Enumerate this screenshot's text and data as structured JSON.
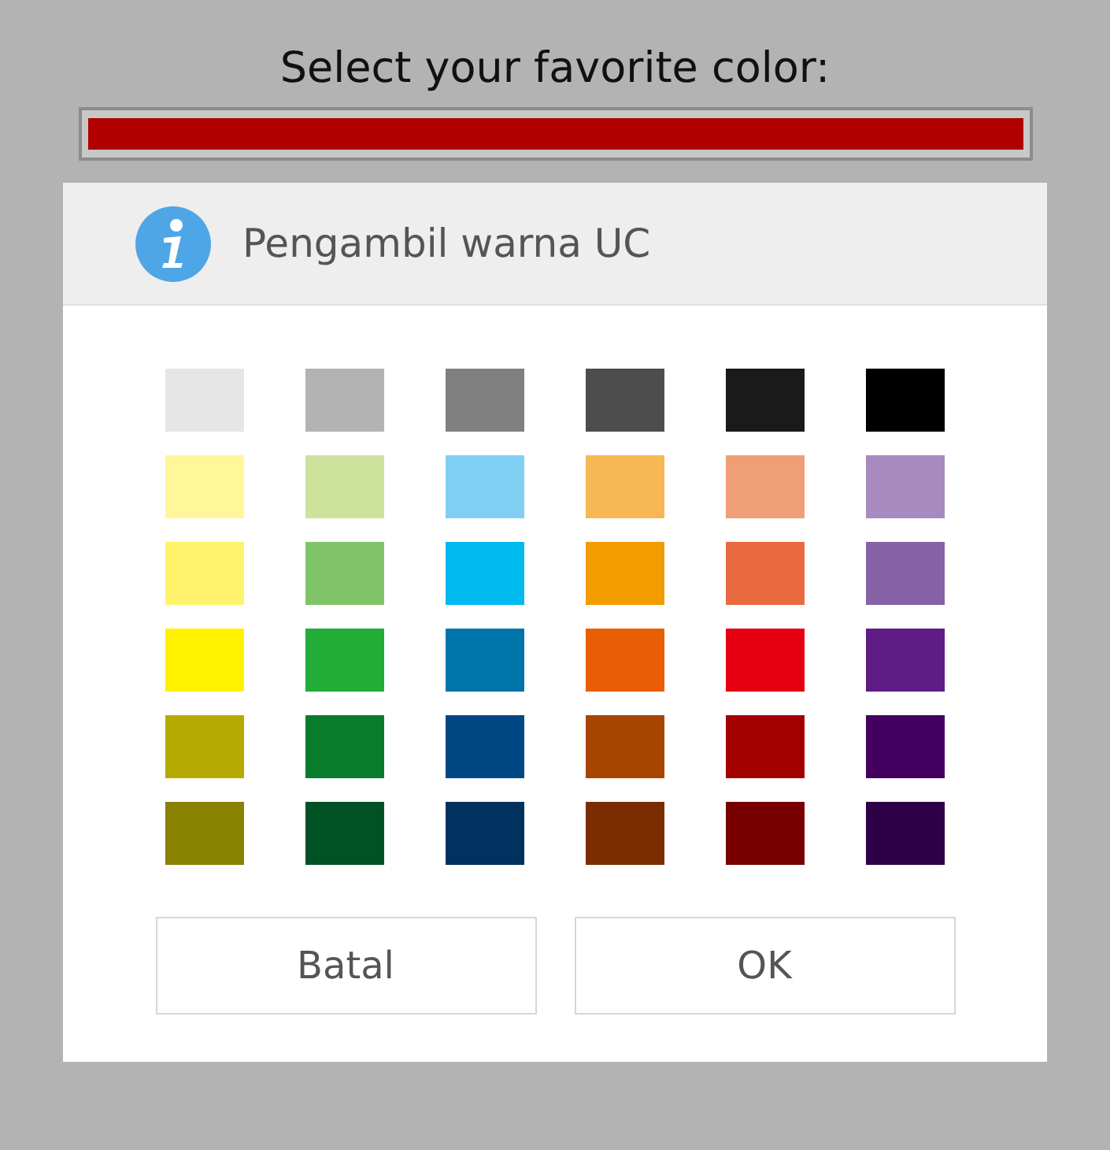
{
  "prompt": "Select your favorite color:",
  "selected_color": {
    "color": "#b00000"
  },
  "dialog": {
    "title": "Pengambil warna UC",
    "swatches": [
      {
        "color": "#e6e6e6"
      },
      {
        "color": "#b3b3b3"
      },
      {
        "color": "#808080"
      },
      {
        "color": "#4d4d4d"
      },
      {
        "color": "#1a1a1a"
      },
      {
        "color": "#000000"
      },
      {
        "color": "#fff799"
      },
      {
        "color": "#cde29c"
      },
      {
        "color": "#7fcff4"
      },
      {
        "color": "#f7b754"
      },
      {
        "color": "#f09e77"
      },
      {
        "color": "#a88abf"
      },
      {
        "color": "#fff36b"
      },
      {
        "color": "#80c46a"
      },
      {
        "color": "#00b9ef"
      },
      {
        "color": "#f39c00"
      },
      {
        "color": "#ea6a40"
      },
      {
        "color": "#8761a5"
      },
      {
        "color": "#fff100"
      },
      {
        "color": "#22ac38"
      },
      {
        "color": "#0075a9"
      },
      {
        "color": "#e95d04"
      },
      {
        "color": "#e60012"
      },
      {
        "color": "#5f1c85"
      },
      {
        "color": "#b5aa00"
      },
      {
        "color": "#097c2c"
      },
      {
        "color": "#004883"
      },
      {
        "color": "#a74400"
      },
      {
        "color": "#a30000"
      },
      {
        "color": "#430060"
      },
      {
        "color": "#898100"
      },
      {
        "color": "#005224"
      },
      {
        "color": "#00325f"
      },
      {
        "color": "#7b2c00"
      },
      {
        "color": "#780000"
      },
      {
        "color": "#2d0047"
      }
    ],
    "buttons": [
      "Batal",
      "OK"
    ]
  }
}
